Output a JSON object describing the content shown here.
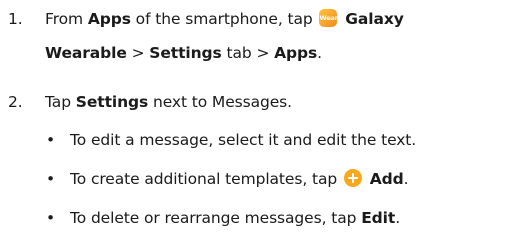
{
  "step1": {
    "number": "1.",
    "text_a": "From ",
    "apps1": "Apps",
    "text_b": " of the smartphone, tap ",
    "wear_icon_text": "Wear",
    "galaxy": "Galaxy",
    "wearable": "Wearable",
    "sep1": " > ",
    "settings_tab": "Settings",
    "text_c": " tab > ",
    "apps2": "Apps",
    "text_d": "."
  },
  "step2": {
    "number": "2.",
    "text_a": "Tap ",
    "settings": "Settings",
    "text_b": " next to Messages."
  },
  "bullets": [
    {
      "marker": "•",
      "text_a": "To edit a message, select it and edit the text."
    },
    {
      "marker": "•",
      "text_a": "To create additional templates, tap ",
      "bold": "Add",
      "text_b": "."
    },
    {
      "marker": "•",
      "text_a": "To delete or rearrange messages, tap ",
      "bold": "Edit",
      "text_b": "."
    }
  ],
  "icons": {
    "wearable_app_icon": "galaxy-wearable-app-icon",
    "add_icon": "add-plus-icon",
    "accent_color": "#f7a91e"
  }
}
